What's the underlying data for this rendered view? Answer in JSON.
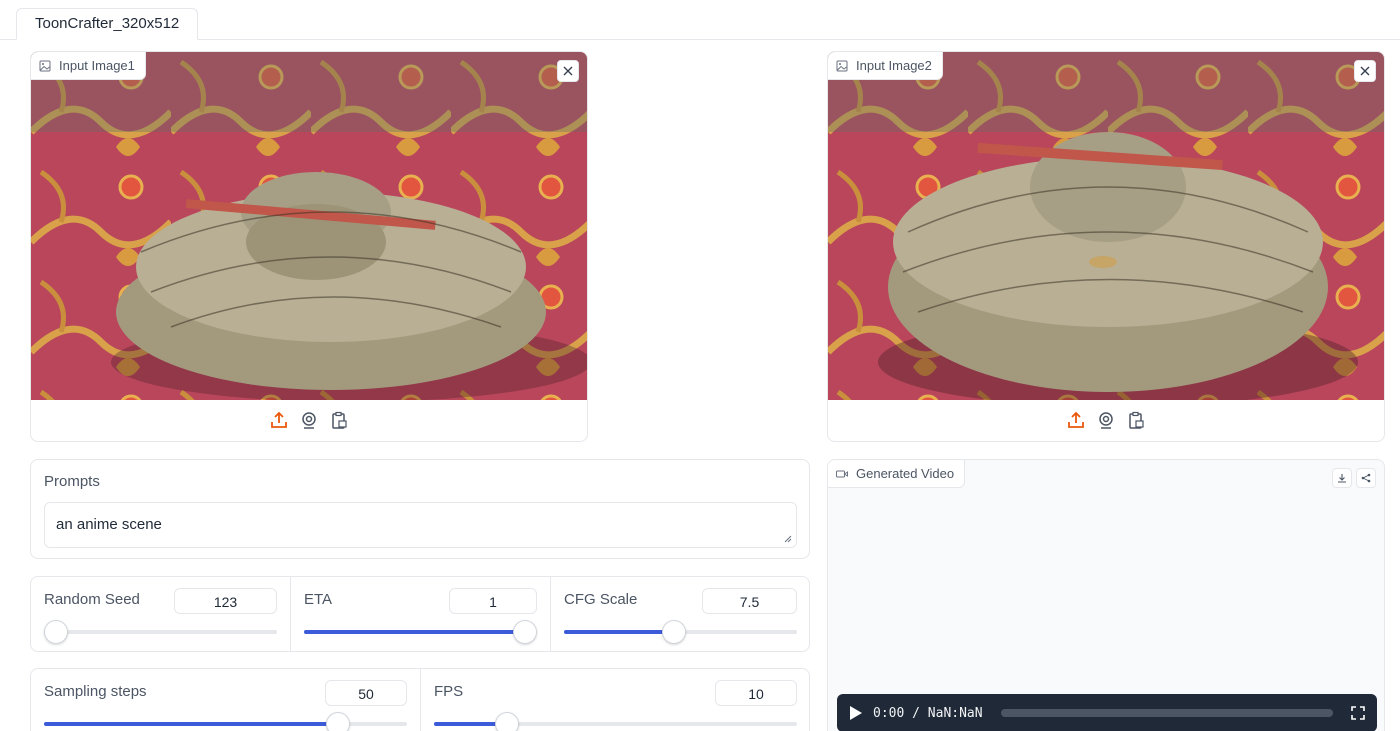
{
  "tab": {
    "label": "ToonCrafter_320x512"
  },
  "input_image1": {
    "label": "Input Image1"
  },
  "input_image2": {
    "label": "Input Image2"
  },
  "prompts": {
    "label": "Prompts",
    "value": "an anime scene"
  },
  "sliders": {
    "random_seed": {
      "label": "Random Seed",
      "value": "123",
      "fraction": 0.05
    },
    "eta": {
      "label": "ETA",
      "value": "1",
      "fraction": 1.0
    },
    "cfg_scale": {
      "label": "CFG Scale",
      "value": "7.5",
      "fraction": 0.47
    },
    "sampling_steps": {
      "label": "Sampling steps",
      "value": "50",
      "fraction": 0.81
    },
    "fps": {
      "label": "FPS",
      "value": "10",
      "fraction": 0.2
    }
  },
  "generated_video": {
    "label": "Generated Video",
    "time": "0:00 / NaN:NaN"
  },
  "colors": {
    "accent": "#3b5bdb",
    "upload_icon": "#ea580c",
    "player_bg": "#1f2937"
  },
  "icons": [
    "image-icon",
    "close-icon",
    "upload-icon",
    "webcam-icon",
    "clipboard-icon",
    "video-icon",
    "download-icon",
    "share-icon",
    "play-icon",
    "fullscreen-icon"
  ]
}
